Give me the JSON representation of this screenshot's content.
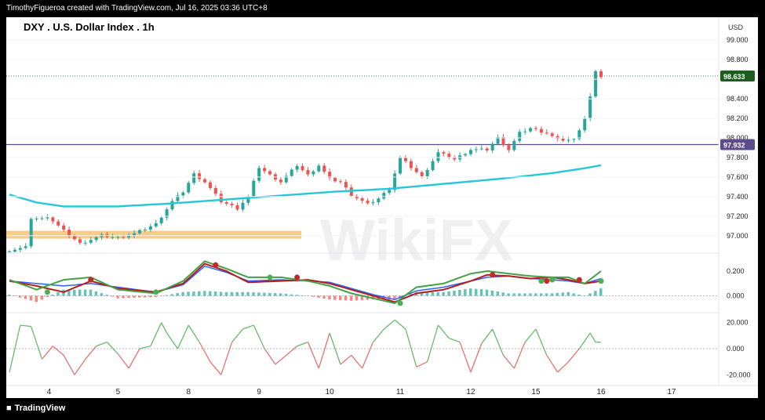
{
  "header": {
    "attribution": "TimothyFigueroa created with TradingView.com, Jul 16, 2025 03:36 UTC+8",
    "footer_brand": "TradingView"
  },
  "chart_title": "DXY . U.S. Dollar Index . 1h",
  "currency": "USD",
  "watermark": "WikiFX",
  "colors": {
    "up": "#26a69a",
    "down": "#ef5350",
    "ma": "#26c6da",
    "support_zone": "#f9c46b",
    "level_line": "#5e4b8b",
    "macd_fast": "#43a047",
    "macd_slow": "#b71c1c",
    "macd_signal": "#2962ff",
    "last_price": "#1b5e20"
  },
  "chart_data": [
    {
      "type": "candlestick",
      "x_ticks": [
        "4",
        "5",
        "8",
        "9",
        "10",
        "11",
        "12",
        "15",
        "16",
        "17"
      ],
      "y_ticks": [
        "99.000",
        "98.800",
        "98.600",
        "98.400",
        "98.200",
        "98.000",
        "97.800",
        "97.600",
        "97.400",
        "97.200",
        "97.000"
      ],
      "ylim": [
        96.83,
        99.17
      ],
      "last_price": 98.633,
      "last_price_label": "98.633",
      "horizontal_level": 97.932,
      "horizontal_level_label": "97.932",
      "support_zone": [
        96.97,
        97.05
      ],
      "key_closes": [
        [
          0,
          96.85
        ],
        [
          3,
          96.88
        ],
        [
          4,
          97.18
        ],
        [
          6,
          97.17
        ],
        [
          7,
          97.2
        ],
        [
          10,
          97.05
        ],
        [
          13,
          96.92
        ],
        [
          17,
          97.0
        ],
        [
          20,
          96.98
        ],
        [
          23,
          97.02
        ],
        [
          27,
          97.12
        ],
        [
          30,
          97.35
        ],
        [
          32,
          97.45
        ],
        [
          34,
          97.63
        ],
        [
          36,
          97.55
        ],
        [
          39,
          97.35
        ],
        [
          42,
          97.28
        ],
        [
          44,
          97.4
        ],
        [
          46,
          97.7
        ],
        [
          48,
          97.62
        ],
        [
          50,
          97.55
        ],
        [
          53,
          97.72
        ],
        [
          55,
          97.62
        ],
        [
          57,
          97.72
        ],
        [
          59,
          97.58
        ],
        [
          61,
          97.55
        ],
        [
          63,
          97.42
        ],
        [
          66,
          97.32
        ],
        [
          68,
          97.38
        ],
        [
          70,
          97.48
        ],
        [
          72,
          97.8
        ],
        [
          74,
          97.7
        ],
        [
          76,
          97.6
        ],
        [
          79,
          97.85
        ],
        [
          82,
          97.78
        ],
        [
          85,
          97.88
        ],
        [
          88,
          97.88
        ],
        [
          90,
          98.0
        ],
        [
          92,
          97.88
        ],
        [
          94,
          98.05
        ],
        [
          96,
          98.1
        ],
        [
          99,
          98.05
        ],
        [
          101,
          97.98
        ],
        [
          104,
          97.98
        ],
        [
          106,
          98.2
        ],
        [
          107,
          98.42
        ],
        [
          108,
          98.67
        ],
        [
          109,
          98.63
        ]
      ],
      "ma": [
        [
          0,
          97.42
        ],
        [
          5,
          97.34
        ],
        [
          10,
          97.3
        ],
        [
          20,
          97.3
        ],
        [
          30,
          97.33
        ],
        [
          40,
          97.37
        ],
        [
          50,
          97.41
        ],
        [
          60,
          97.45
        ],
        [
          70,
          97.48
        ],
        [
          80,
          97.53
        ],
        [
          90,
          97.58
        ],
        [
          100,
          97.64
        ],
        [
          106,
          97.69
        ],
        [
          109,
          97.72
        ]
      ]
    },
    {
      "type": "macd",
      "y_ticks": [
        "0.200",
        "0.000"
      ],
      "ylim": [
        -0.13,
        0.34
      ],
      "fast": [
        [
          0,
          0.13
        ],
        [
          5,
          0.05
        ],
        [
          10,
          0.13
        ],
        [
          15,
          0.15
        ],
        [
          20,
          0.05
        ],
        [
          27,
          0.02
        ],
        [
          32,
          0.12
        ],
        [
          36,
          0.28
        ],
        [
          40,
          0.22
        ],
        [
          44,
          0.15
        ],
        [
          50,
          0.15
        ],
        [
          55,
          0.12
        ],
        [
          59,
          0.08
        ],
        [
          63,
          0.02
        ],
        [
          67,
          -0.02
        ],
        [
          71,
          -0.06
        ],
        [
          75,
          0.07
        ],
        [
          80,
          0.1
        ],
        [
          85,
          0.18
        ],
        [
          88,
          0.2
        ],
        [
          92,
          0.18
        ],
        [
          96,
          0.16
        ],
        [
          100,
          0.15
        ],
        [
          103,
          0.15
        ],
        [
          106,
          0.1
        ],
        [
          109,
          0.2
        ]
      ],
      "slow": [
        [
          0,
          0.12
        ],
        [
          5,
          0.08
        ],
        [
          10,
          0.03
        ],
        [
          15,
          0.12
        ],
        [
          20,
          0.06
        ],
        [
          27,
          0.03
        ],
        [
          32,
          0.1
        ],
        [
          36,
          0.26
        ],
        [
          40,
          0.2
        ],
        [
          44,
          0.11
        ],
        [
          50,
          0.12
        ],
        [
          55,
          0.13
        ],
        [
          59,
          0.1
        ],
        [
          63,
          0.05
        ],
        [
          67,
          0.0
        ],
        [
          71,
          -0.05
        ],
        [
          75,
          0.02
        ],
        [
          80,
          0.05
        ],
        [
          85,
          0.12
        ],
        [
          88,
          0.17
        ],
        [
          92,
          0.16
        ],
        [
          96,
          0.14
        ],
        [
          100,
          0.15
        ],
        [
          103,
          0.13
        ],
        [
          106,
          0.1
        ],
        [
          109,
          0.12
        ]
      ],
      "signal": [
        [
          0,
          0.12
        ],
        [
          5,
          0.1
        ],
        [
          10,
          0.08
        ],
        [
          15,
          0.1
        ],
        [
          20,
          0.07
        ],
        [
          27,
          0.03
        ],
        [
          32,
          0.09
        ],
        [
          36,
          0.24
        ],
        [
          40,
          0.19
        ],
        [
          44,
          0.12
        ],
        [
          50,
          0.13
        ],
        [
          55,
          0.12
        ],
        [
          59,
          0.11
        ],
        [
          63,
          0.06
        ],
        [
          67,
          0.01
        ],
        [
          71,
          -0.03
        ],
        [
          75,
          0.04
        ],
        [
          80,
          0.07
        ],
        [
          85,
          0.12
        ],
        [
          88,
          0.15
        ],
        [
          92,
          0.16
        ],
        [
          96,
          0.14
        ],
        [
          100,
          0.13
        ],
        [
          103,
          0.12
        ],
        [
          106,
          0.1
        ],
        [
          109,
          0.14
        ]
      ],
      "cross_dots": [
        {
          "x": 7,
          "y": 0.03,
          "c": "g"
        },
        {
          "x": 15,
          "y": 0.13,
          "c": "r"
        },
        {
          "x": 27,
          "y": 0.03,
          "c": "g"
        },
        {
          "x": 38,
          "y": 0.25,
          "c": "r"
        },
        {
          "x": 48,
          "y": 0.15,
          "c": "g"
        },
        {
          "x": 53,
          "y": 0.15,
          "c": "r"
        },
        {
          "x": 72,
          "y": -0.06,
          "c": "g"
        },
        {
          "x": 89,
          "y": 0.17,
          "c": "r"
        },
        {
          "x": 98,
          "y": 0.12,
          "c": "g"
        },
        {
          "x": 99,
          "y": 0.12,
          "c": "r"
        },
        {
          "x": 100,
          "y": 0.13,
          "c": "g"
        },
        {
          "x": 105,
          "y": 0.13,
          "c": "r"
        },
        {
          "x": 109,
          "y": 0.12,
          "c": "g"
        }
      ]
    },
    {
      "type": "oscillator",
      "y_ticks": [
        "20.000",
        "0.000",
        "-20.000"
      ],
      "ylim": [
        -27,
        27
      ],
      "values": [
        [
          0,
          -18
        ],
        [
          2,
          18
        ],
        [
          4,
          17
        ],
        [
          6,
          -8
        ],
        [
          8,
          2
        ],
        [
          10,
          -5
        ],
        [
          12,
          -20
        ],
        [
          14,
          -8
        ],
        [
          16,
          2
        ],
        [
          18,
          5
        ],
        [
          20,
          -4
        ],
        [
          22,
          -15
        ],
        [
          24,
          0
        ],
        [
          26,
          2
        ],
        [
          28,
          20
        ],
        [
          29,
          12
        ],
        [
          31,
          0
        ],
        [
          33,
          18
        ],
        [
          35,
          5
        ],
        [
          37,
          -10
        ],
        [
          39,
          -20
        ],
        [
          41,
          5
        ],
        [
          43,
          15
        ],
        [
          45,
          18
        ],
        [
          47,
          0
        ],
        [
          49,
          -12
        ],
        [
          51,
          -5
        ],
        [
          53,
          2
        ],
        [
          55,
          5
        ],
        [
          57,
          -15
        ],
        [
          59,
          12
        ],
        [
          61,
          -12
        ],
        [
          63,
          -5
        ],
        [
          65,
          -15
        ],
        [
          67,
          5
        ],
        [
          69,
          15
        ],
        [
          71,
          22
        ],
        [
          73,
          15
        ],
        [
          75,
          -14
        ],
        [
          77,
          -10
        ],
        [
          79,
          18
        ],
        [
          81,
          8
        ],
        [
          83,
          5
        ],
        [
          85,
          -18
        ],
        [
          87,
          4
        ],
        [
          89,
          15
        ],
        [
          91,
          -5
        ],
        [
          93,
          -15
        ],
        [
          95,
          5
        ],
        [
          97,
          15
        ],
        [
          99,
          -5
        ],
        [
          101,
          -18
        ],
        [
          103,
          -10
        ],
        [
          105,
          0
        ],
        [
          107,
          12
        ],
        [
          108,
          5
        ],
        [
          109,
          5
        ]
      ]
    }
  ]
}
